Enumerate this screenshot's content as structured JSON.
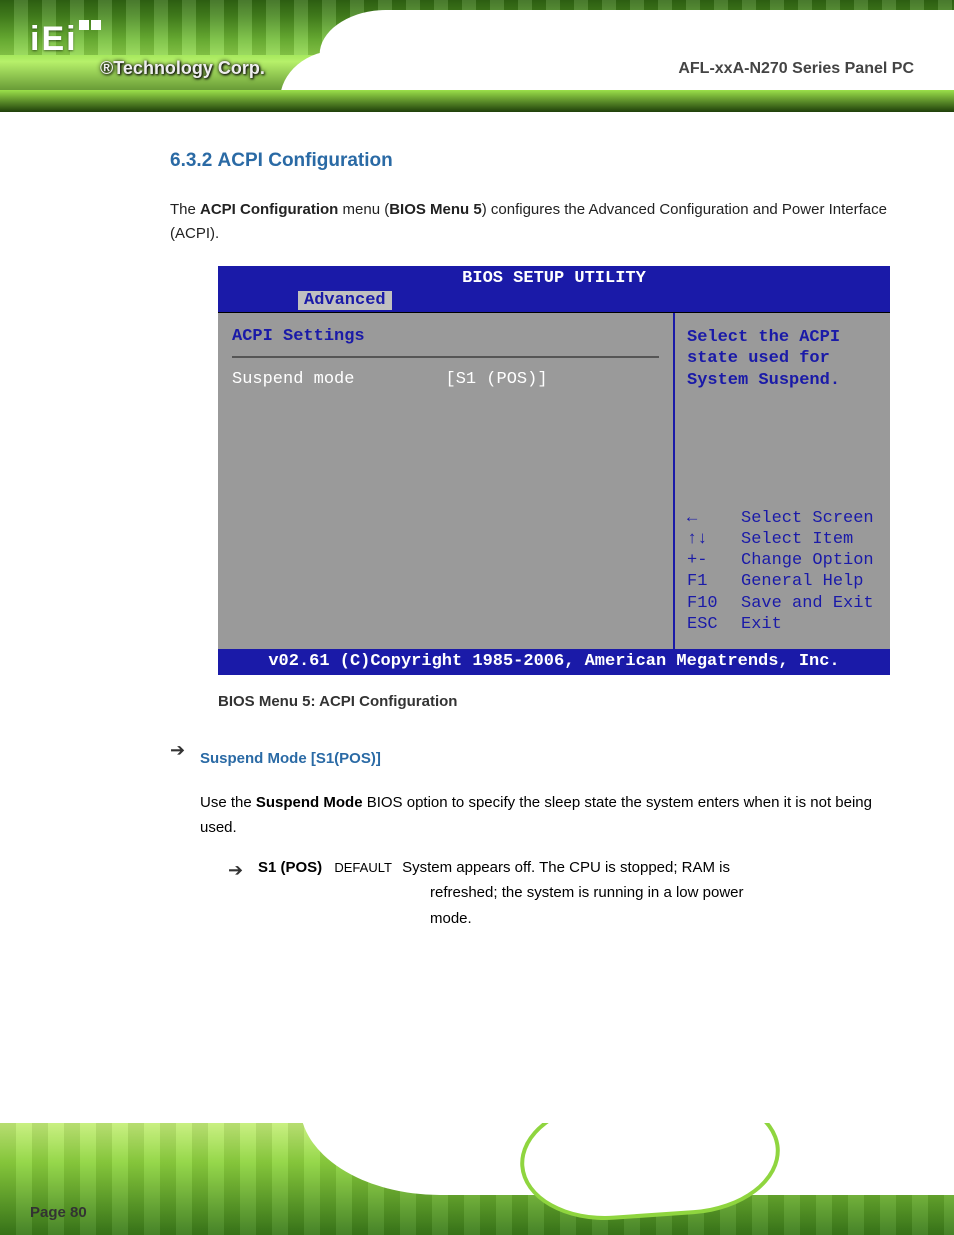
{
  "brand": {
    "logo_text": "iEi",
    "tagline": "®Technology Corp."
  },
  "doc_title": "AFL-xxA-N270 Series Panel PC",
  "section": {
    "number": "6.3.2",
    "title": "ACPI Configuration"
  },
  "intro": {
    "prefix": "The ",
    "menu_name": "ACPI Configuration",
    "mid": " menu (",
    "figref": "BIOS Menu 5",
    "suffix": ") configures the Advanced Configuration and Power Interface (ACPI)."
  },
  "bios": {
    "utility_title": "BIOS SETUP UTILITY",
    "active_tab": "Advanced",
    "panel_title": "ACPI Settings",
    "rows": [
      {
        "label": "Suspend mode",
        "value": "[S1 (POS)]"
      }
    ],
    "help": "Select the ACPI state used for System Suspend.",
    "keys": [
      {
        "k": "←",
        "d": "Select Screen"
      },
      {
        "k": "↑↓",
        "d": "Select Item"
      },
      {
        "k": "+-",
        "d": "Change Option"
      },
      {
        "k": "F1",
        "d": "General Help"
      },
      {
        "k": "F10",
        "d": "Save and Exit"
      },
      {
        "k": "ESC",
        "d": "Exit"
      }
    ],
    "footer": "v02.61 (C)Copyright 1985-2006, American Megatrends, Inc."
  },
  "caption": "BIOS Menu 5: ACPI Configuration",
  "suspend_hd": "Suspend Mode [S1(POS)]",
  "suspend_intro": {
    "prefix": "Use the ",
    "bold": "Suspend Mode",
    "mid": " BIOS option to specify the sleep state the system enters when it is not being used."
  },
  "option": {
    "label": "S1 (POS)",
    "tag": "DEFAULT",
    "desc_1": "System appears off. The CPU is stopped; RAM is",
    "desc_2": "refreshed; the system is running in a low power",
    "desc_3": "mode."
  },
  "page_label": "Page 80"
}
